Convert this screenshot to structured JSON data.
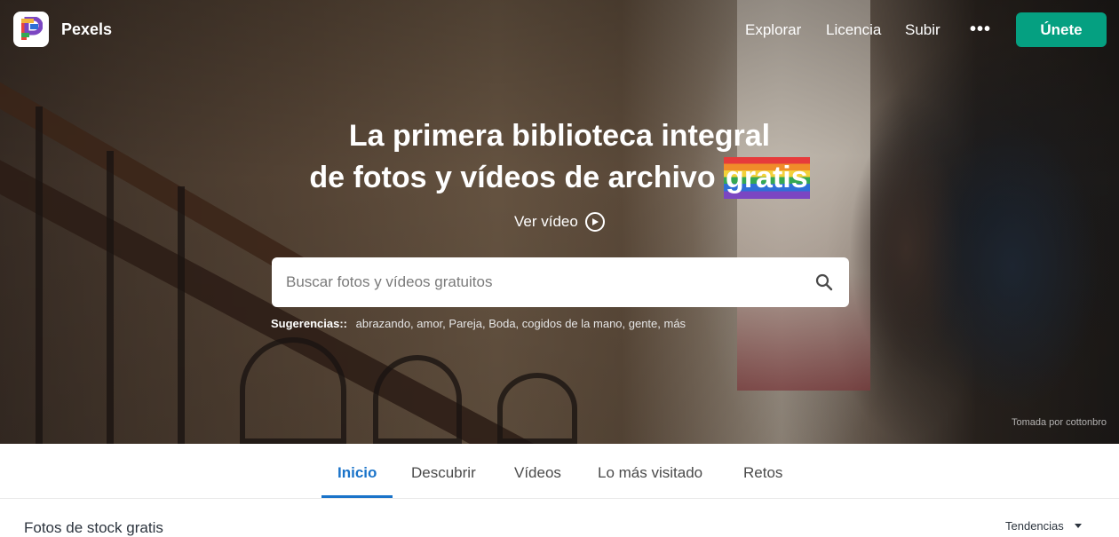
{
  "brand": {
    "name": "Pexels"
  },
  "nav": {
    "links": [
      "Explorar",
      "Licencia",
      "Subir"
    ],
    "more_icon": "more-dots-icon",
    "join_label": "Únete"
  },
  "hero": {
    "line1": "La primera biblioteca integral",
    "line2_prefix": "de fotos y vídeos de archivo",
    "line2_highlight": "gratis",
    "video_label": "Ver vídeo",
    "video_icon": "play-circle-icon",
    "search_placeholder": "Buscar fotos y vídeos gratuitos",
    "search_icon": "search-icon",
    "suggestions_label": "Sugerencias::",
    "suggestions": "abrazando, amor, Pareja, Boda, cogidos de la mano, gente, más",
    "credit": "Tomada por cottonbro"
  },
  "tabs": [
    {
      "label": "Inicio",
      "active": true
    },
    {
      "label": "Descubrir",
      "active": false
    },
    {
      "label": "Vídeos",
      "active": false
    },
    {
      "label": "Lo más visitado",
      "active": false
    },
    {
      "label": "Retos",
      "active": false
    }
  ],
  "content": {
    "section_title": "Fotos de stock gratis",
    "sort_label": "Tendencias"
  },
  "colors": {
    "accent": "#05a081",
    "tab_active": "#1a73c9"
  }
}
